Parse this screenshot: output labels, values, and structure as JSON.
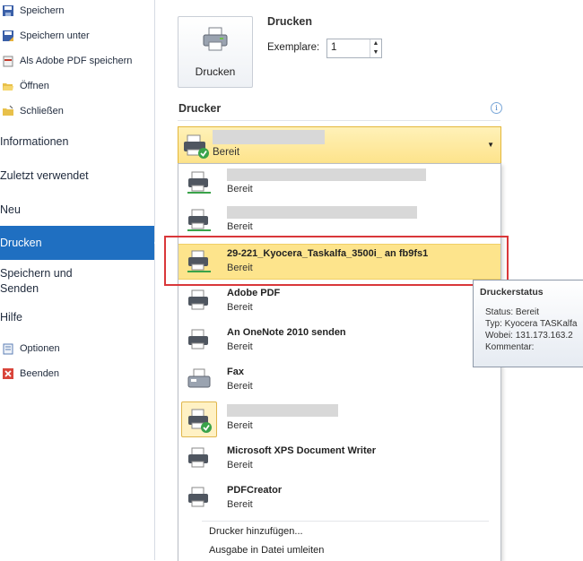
{
  "sidebar": {
    "top_items": [
      {
        "label": "Speichern",
        "icon": "save-icon"
      },
      {
        "label": "Speichern unter",
        "icon": "save-as-icon"
      },
      {
        "label": "Als Adobe PDF speichern",
        "icon": "pdf-save-icon"
      },
      {
        "label": "Öffnen",
        "icon": "open-folder-icon"
      },
      {
        "label": "Schließen",
        "icon": "close-folder-icon"
      }
    ],
    "nav_items": [
      {
        "label": "Informationen"
      },
      {
        "label": "Zuletzt verwendet"
      },
      {
        "label": "Neu"
      },
      {
        "label": "Drucken",
        "active": true
      },
      {
        "label": "Speichern und"
      },
      {
        "label": "Senden"
      },
      {
        "label": "Hilfe"
      }
    ],
    "bottom_items": [
      {
        "label": "Optionen",
        "icon": "options-icon"
      },
      {
        "label": "Beenden",
        "icon": "exit-icon"
      }
    ]
  },
  "print": {
    "button_label": "Drucken",
    "heading": "Drucken",
    "copies_label": "Exemplare:",
    "copies_value": "1"
  },
  "printer_section": {
    "heading": "Drucker",
    "selected_status": "Bereit"
  },
  "printer_list": [
    {
      "name": "",
      "status": "Bereit"
    },
    {
      "name": "",
      "status": "Bereit"
    },
    {
      "name": "29-221_Kyocera_Taskalfa_3500i_   an fb9fs1",
      "status": "Bereit",
      "highlighted": true
    },
    {
      "name": "Adobe PDF",
      "status": "Bereit"
    },
    {
      "name": "An OneNote 2010 senden",
      "status": "Bereit"
    },
    {
      "name": "Fax",
      "status": "Bereit"
    },
    {
      "name": "",
      "status": "Bereit",
      "default": true
    },
    {
      "name": "Microsoft XPS Document Writer",
      "status": "Bereit"
    },
    {
      "name": "PDFCreator",
      "status": "Bereit"
    }
  ],
  "list_actions": {
    "add_printer": "Drucker hinzufügen...",
    "print_to_file": "Ausgabe in Datei umleiten"
  },
  "tooltip": {
    "title": "Druckerstatus",
    "status": "Status: Bereit",
    "type": "Typ: Kyocera TASKalfa",
    "where": "Wobei: 131.173.163.2",
    "comment": "Kommentar:"
  },
  "colors": {
    "active_nav": "#1f6fc1",
    "highlight": "#fde48c",
    "highlight_frame": "#d9373a"
  }
}
